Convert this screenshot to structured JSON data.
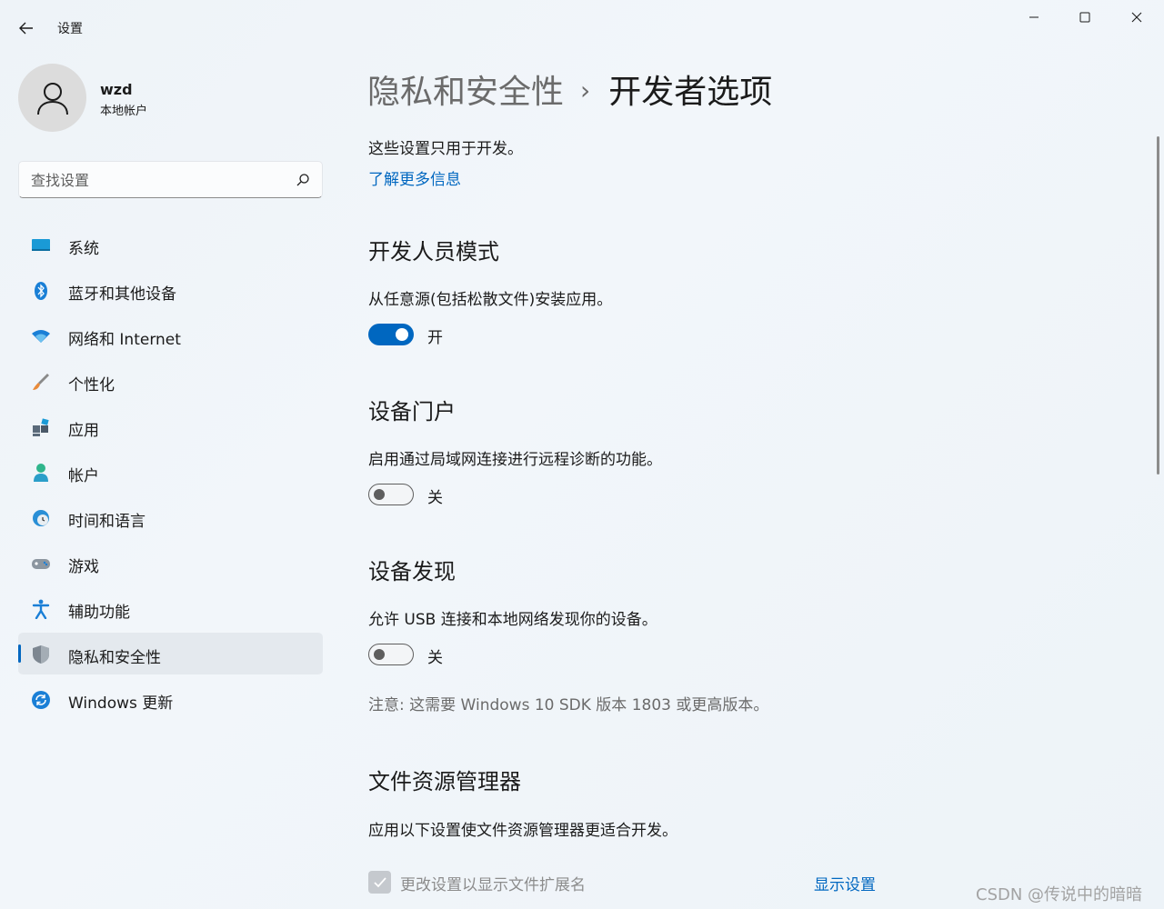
{
  "window": {
    "title": "设置"
  },
  "user": {
    "name": "wzd",
    "account_type": "本地帐户"
  },
  "search": {
    "placeholder": "查找设置"
  },
  "sidebar": {
    "items": [
      {
        "label": "系统",
        "icon": "system-icon"
      },
      {
        "label": "蓝牙和其他设备",
        "icon": "bluetooth-icon"
      },
      {
        "label": "网络和 Internet",
        "icon": "wifi-icon"
      },
      {
        "label": "个性化",
        "icon": "brush-icon"
      },
      {
        "label": "应用",
        "icon": "apps-icon"
      },
      {
        "label": "帐户",
        "icon": "account-icon"
      },
      {
        "label": "时间和语言",
        "icon": "time-language-icon"
      },
      {
        "label": "游戏",
        "icon": "gamepad-icon"
      },
      {
        "label": "辅助功能",
        "icon": "accessibility-icon"
      },
      {
        "label": "隐私和安全性",
        "icon": "shield-icon",
        "active": true
      },
      {
        "label": "Windows 更新",
        "icon": "update-icon"
      }
    ]
  },
  "breadcrumb": {
    "parent": "隐私和安全性",
    "separator": "›",
    "current": "开发者选项"
  },
  "main": {
    "intro": "这些设置只用于开发。",
    "learn_more": "了解更多信息",
    "developer_mode": {
      "title": "开发人员模式",
      "description": "从任意源(包括松散文件)安装应用。",
      "state": "开"
    },
    "device_portal": {
      "title": "设备门户",
      "description": "启用通过局域网连接进行远程诊断的功能。",
      "state": "关"
    },
    "device_discovery": {
      "title": "设备发现",
      "description": "允许 USB 连接和本地网络发现你的设备。",
      "state": "关",
      "note": "注意: 这需要 Windows 10 SDK 版本 1803 或更高版本。"
    },
    "file_explorer": {
      "title": "文件资源管理器",
      "description": "应用以下设置使文件资源管理器更适合开发。",
      "checkbox_label": "更改设置以显示文件扩展名",
      "show_settings": "显示设置"
    }
  },
  "watermark": "CSDN @传说中的暗暗",
  "colors": {
    "accent": "#0067c0",
    "background": "#eef3f8"
  }
}
